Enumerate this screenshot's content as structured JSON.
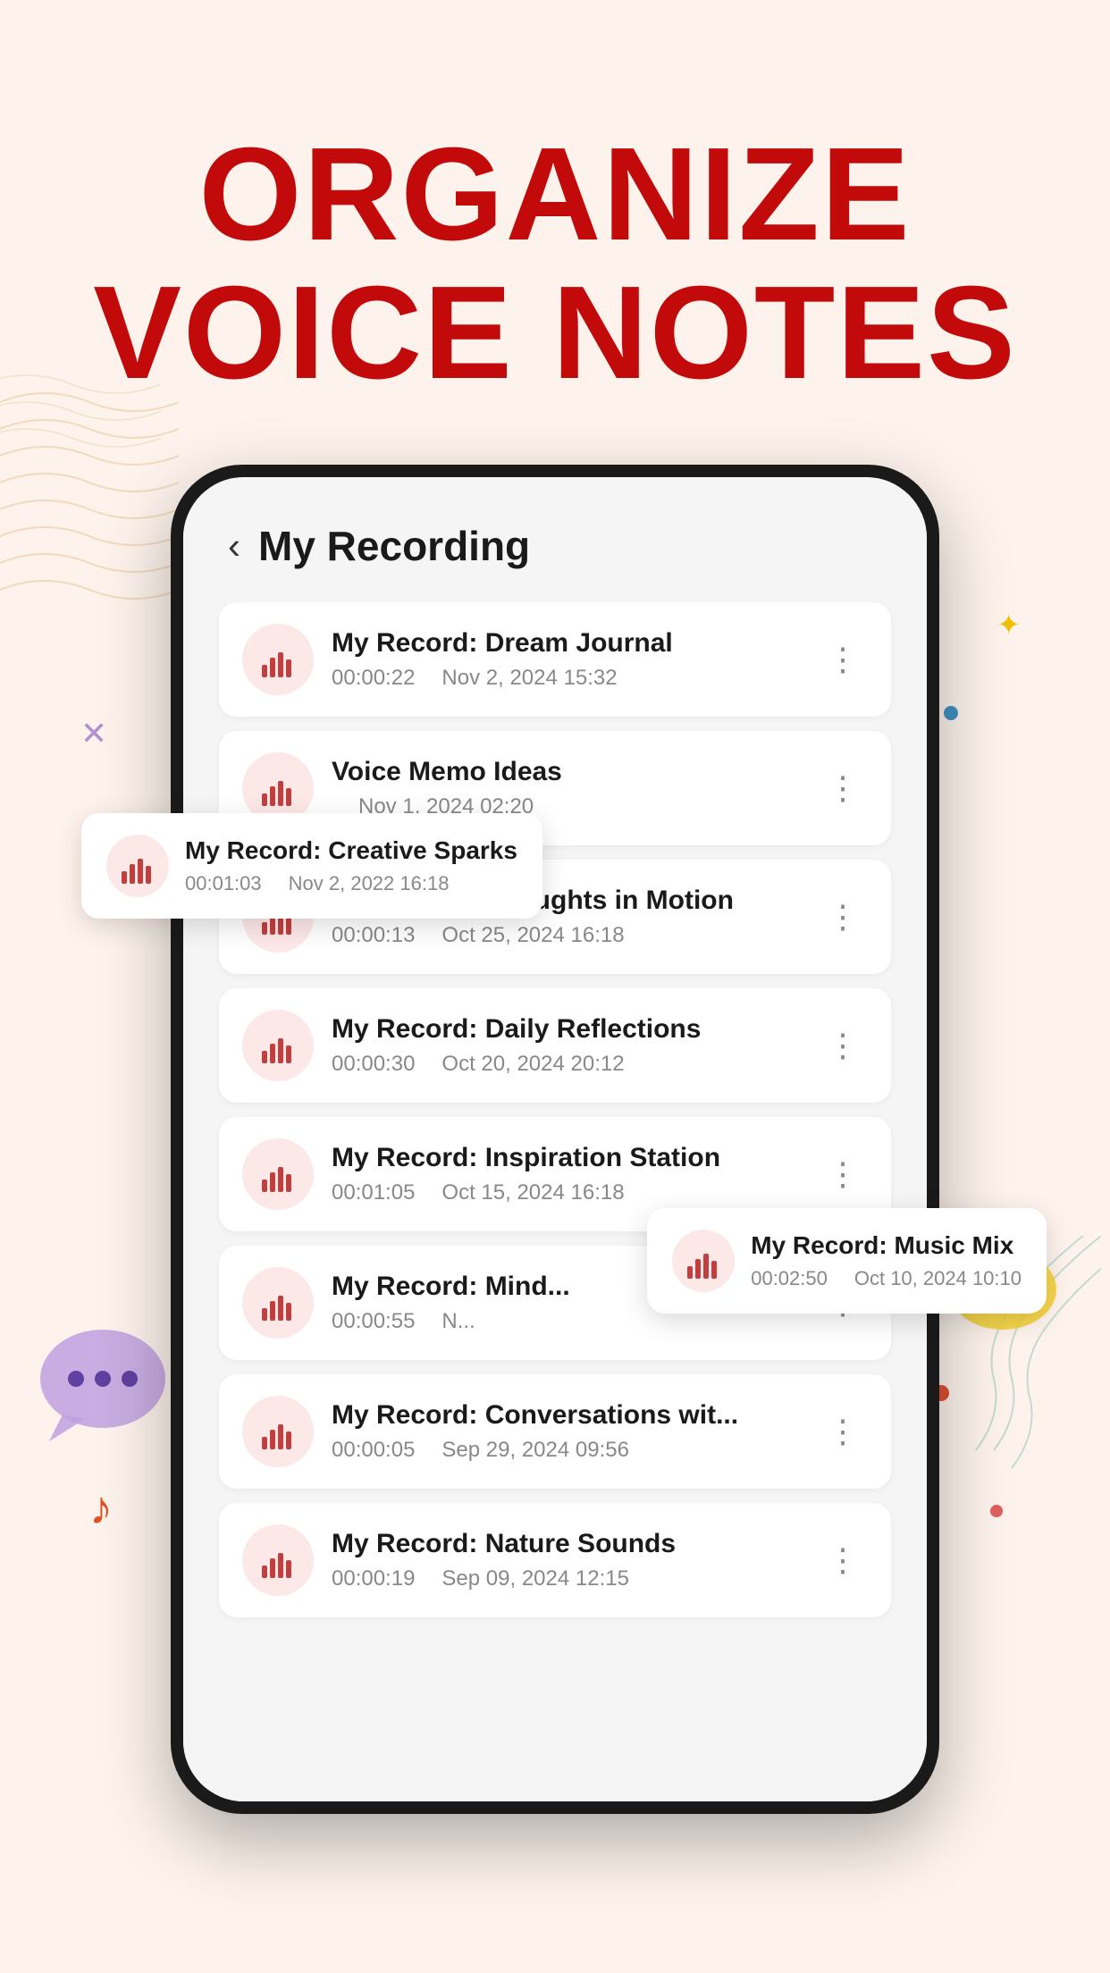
{
  "headline": {
    "line1": "ORGANIZE",
    "line2": "VOICE NOTES"
  },
  "screen": {
    "title": "My Recording",
    "back_label": "<"
  },
  "recordings": [
    {
      "id": 1,
      "name": "My Record: Dream Journal",
      "duration": "00:00:22",
      "date": "Nov 2, 2024 15:32"
    },
    {
      "id": 2,
      "name": "Voice Memo Ideas",
      "duration": "",
      "date": "Nov 1, 2024 02:20"
    },
    {
      "id": 3,
      "name": "My Record: Thoughts in Motion",
      "duration": "00:00:13",
      "date": "Oct 25, 2024 16:18"
    },
    {
      "id": 4,
      "name": "My Record: Daily Reflections",
      "duration": "00:00:30",
      "date": "Oct 20, 2024 20:12"
    },
    {
      "id": 5,
      "name": "My Record: Inspiration Station",
      "duration": "00:01:05",
      "date": "Oct 15, 2024 16:18"
    },
    {
      "id": 6,
      "name": "My Record: Mind...",
      "duration": "00:00:55",
      "date": "N..."
    },
    {
      "id": 7,
      "name": "My Record: Conversations wit...",
      "duration": "00:00:05",
      "date": "Sep 29, 2024 09:56"
    },
    {
      "id": 8,
      "name": "My Record: Nature Sounds",
      "duration": "00:00:19",
      "date": "Sep 09, 2024 12:15"
    }
  ],
  "tooltip_creative": {
    "name": "My Record: Creative Sparks",
    "duration": "00:01:03",
    "date": "Nov 2, 2022 16:18"
  },
  "tooltip_music": {
    "name": "My Record: Music Mix",
    "duration": "00:02:50",
    "date": "Oct 10, 2024 10:10"
  }
}
